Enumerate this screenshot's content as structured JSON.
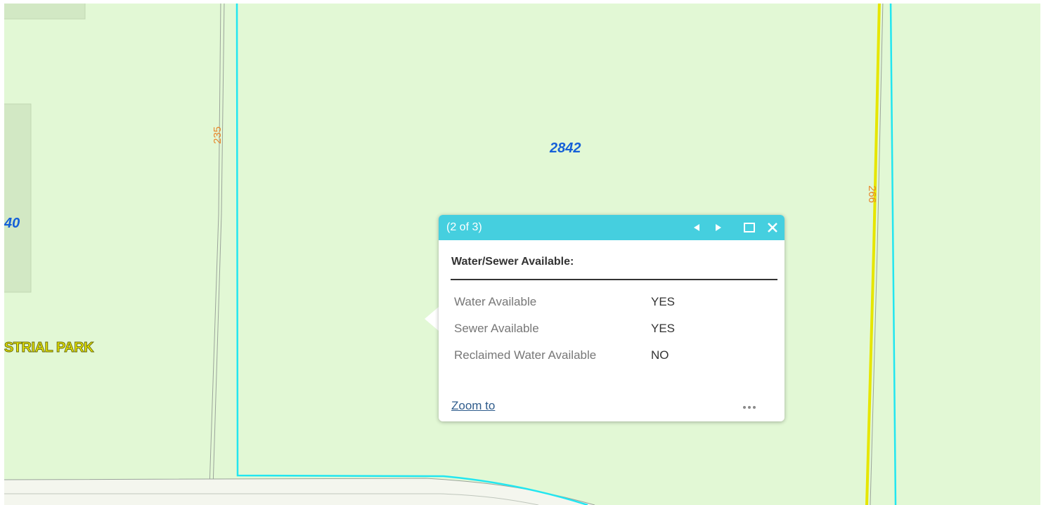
{
  "map": {
    "colors": {
      "parcel_fill": "#e2f8d5",
      "parcel_boundary": "#22e6f0",
      "road_line": "#9aa39a",
      "highlight": "#e6e600",
      "parcel_label": "#1560d8",
      "road_label": "#e8862a"
    },
    "parcel_labels": [
      "2842",
      "40"
    ],
    "road_labels": [
      "235",
      "266"
    ],
    "place_label": "STRIAL PARK"
  },
  "popup": {
    "count": "(2 of 3)",
    "title": "Water/Sewer Available:",
    "header_color": "#45cfdf",
    "header_icons": [
      "previous-icon",
      "next-icon",
      "maximize-icon",
      "close-icon"
    ],
    "attributes": [
      {
        "name": "Water Available",
        "value": "YES"
      },
      {
        "name": "Sewer Available",
        "value": "YES"
      },
      {
        "name": "Reclaimed Water Available",
        "value": "NO"
      }
    ],
    "zoom_link": "Zoom to",
    "more_icon": "ellipsis-icon"
  }
}
